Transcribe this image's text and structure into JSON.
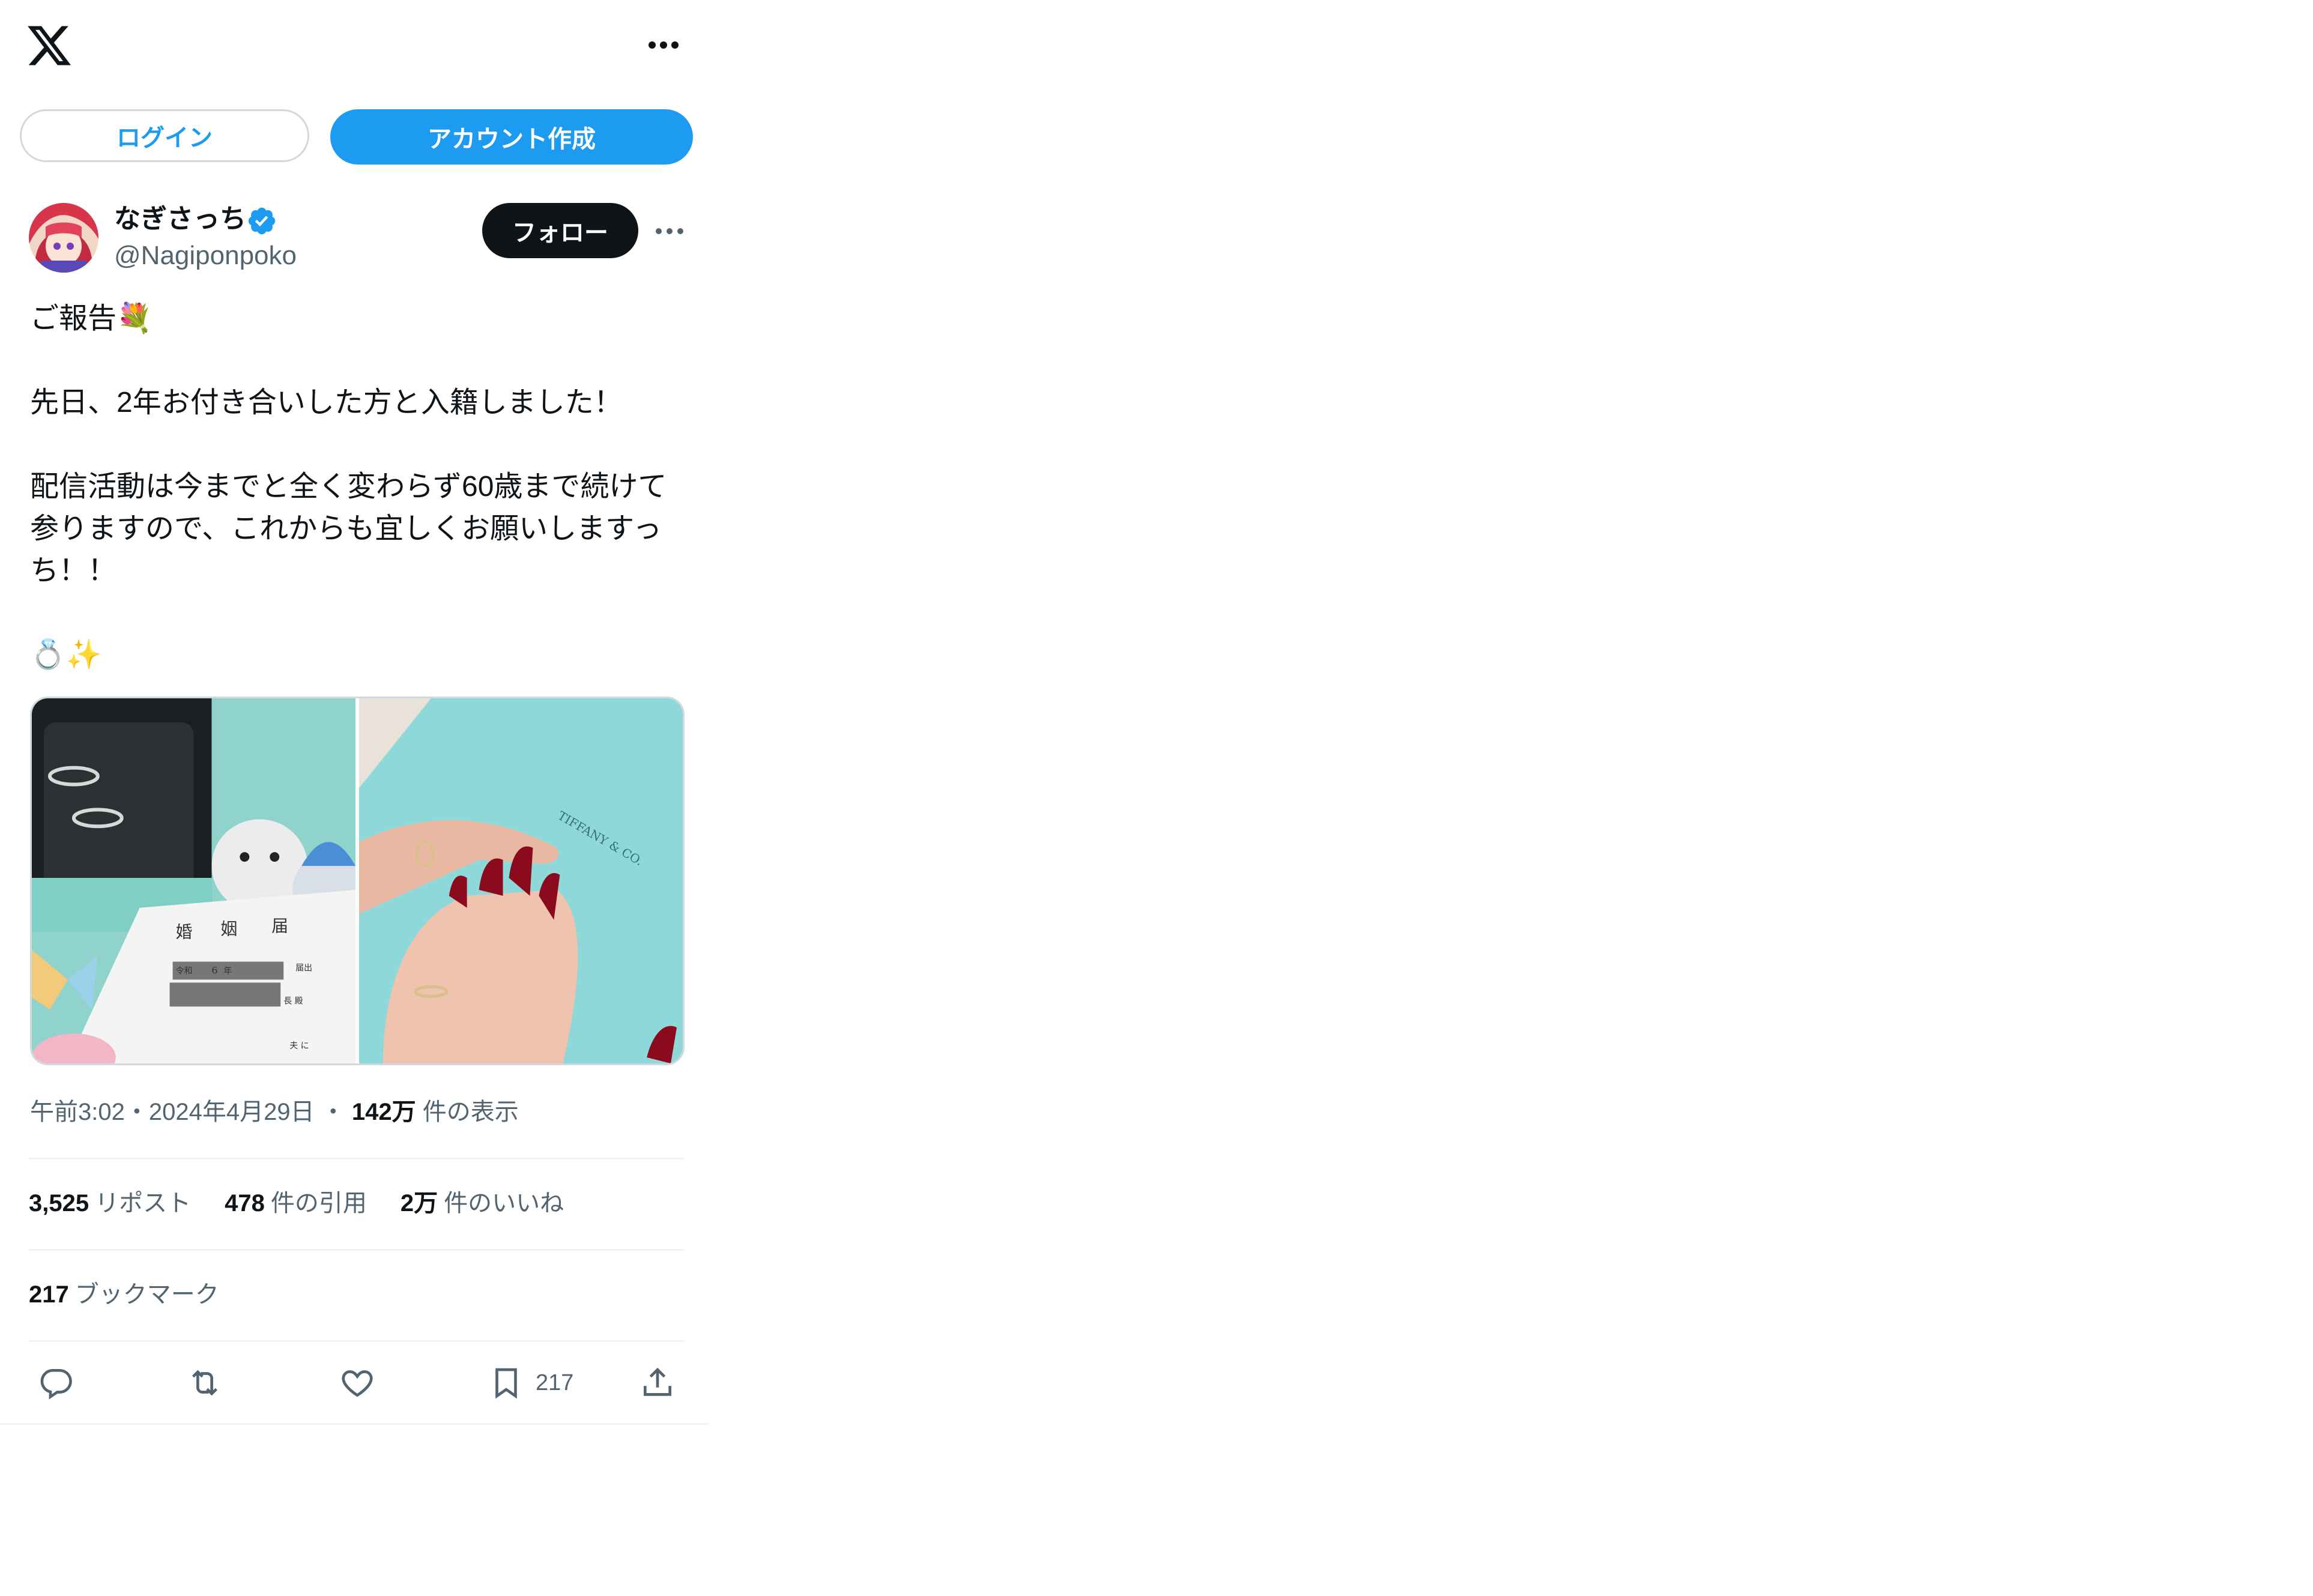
{
  "header": {
    "logo_icon": "x-logo-icon",
    "more_icon": "more-horizontal-icon",
    "login_label": "ログイン",
    "signup_label": "アカウント作成"
  },
  "author": {
    "name": "なぎさっち",
    "handle": "@Nagiponpoko",
    "verified_icon": "verified-badge-icon",
    "follow_label": "フォロー"
  },
  "post": {
    "lines": [
      "ご報告💐",
      "",
      "先日、2年お付き合いした方と入籍しました！",
      "",
      "配信活動は今までと全く変わらず60歳まで続けて",
      "参りますので、これからも宜しくお願いしますっ",
      "ち！！",
      "",
      "💍✨"
    ],
    "media": [
      {
        "kind": "photo",
        "icon": "photo-rings-box-icon",
        "text_1": "婚",
        "text_2": "姻",
        "text_3": "届",
        "text_4": "令和",
        "text_5": "6",
        "text_6": "年",
        "text_7": "届出",
        "text_8": "長 殿",
        "text_9": "夫 に"
      },
      {
        "kind": "photo",
        "icon": "photo-hands-rings-icon",
        "text_1": "TIFFANY & CO."
      }
    ]
  },
  "meta": {
    "time": "午前3:02",
    "sep1": "・",
    "date": "2024年4月29日",
    "sep2": "・",
    "views_count": "142万",
    "views_label": "件の表示"
  },
  "stats": {
    "reposts_count": "3,525",
    "reposts_label": "リポスト",
    "quotes_count": "478",
    "quotes_label": "件の引用",
    "likes_count": "2万",
    "likes_label": "件のいいね",
    "bookmarks_count": "217",
    "bookmarks_label": "ブックマーク"
  },
  "actions": {
    "reply_icon": "reply-icon",
    "repost_icon": "repost-icon",
    "like_icon": "heart-icon",
    "bookmark_icon": "bookmark-icon",
    "bookmark_count": "217",
    "share_icon": "share-icon"
  },
  "colors": {
    "accent": "#1d9bf0",
    "text": "#0f1419",
    "muted": "#536471",
    "border": "#cfd9de"
  }
}
